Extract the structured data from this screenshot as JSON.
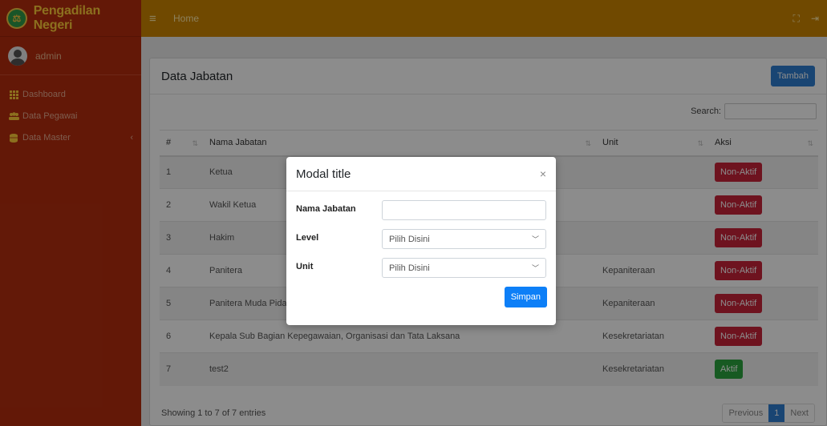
{
  "brand": {
    "title": "Pengadilan Negeri",
    "logo_icon": "court-emblem-icon"
  },
  "user": {
    "name": "admin"
  },
  "sidebar": {
    "items": [
      {
        "label": "Dashboard",
        "icon": "grid-icon"
      },
      {
        "label": "Data Pegawai",
        "icon": "users-icon"
      },
      {
        "label": "Data Master",
        "icon": "database-icon"
      }
    ]
  },
  "topbar": {
    "home_label": "Home"
  },
  "card": {
    "title": "Data Jabatan",
    "add_button": "Tambah",
    "search_label": "Search:"
  },
  "table": {
    "headers": {
      "num": "#",
      "name": "Nama Jabatan",
      "unit": "Unit",
      "action": "Aksi"
    },
    "rows": [
      {
        "num": "1",
        "name": "Ketua",
        "unit": "",
        "action": "Non-Aktif"
      },
      {
        "num": "2",
        "name": "Wakil Ketua",
        "unit": "",
        "action": "Non-Aktif"
      },
      {
        "num": "3",
        "name": "Hakim",
        "unit": "",
        "action": "Non-Aktif"
      },
      {
        "num": "4",
        "name": "Panitera",
        "unit": "Kepaniteraan",
        "action": "Non-Aktif"
      },
      {
        "num": "5",
        "name": "Panitera Muda Pida",
        "unit": "Kepaniteraan",
        "action": "Non-Aktif"
      },
      {
        "num": "6",
        "name": "Kepala Sub Bagian Kepegawaian, Organisasi dan Tata Laksana",
        "unit": "Kesekretariatan",
        "action": "Non-Aktif"
      },
      {
        "num": "7",
        "name": "test2",
        "unit": "Kesekretariatan",
        "action": "Aktif"
      }
    ]
  },
  "footer": {
    "info": "Showing 1 to 7 of 7 entries",
    "prev": "Previous",
    "page": "1",
    "next": "Next"
  },
  "modal": {
    "title": "Modal title",
    "close": "×",
    "fields": {
      "nama_jabatan": {
        "label": "Nama Jabatan",
        "value": ""
      },
      "level": {
        "label": "Level",
        "selected": "Pilih Disini"
      },
      "unit": {
        "label": "Unit",
        "selected": "Pilih Disini"
      }
    },
    "submit": "Simpan"
  },
  "colors": {
    "sidebar": "#b52d0e",
    "topbar": "#cc8500",
    "primary": "#2f7fd1",
    "danger": "#c8233a",
    "success": "#2aa53e"
  }
}
